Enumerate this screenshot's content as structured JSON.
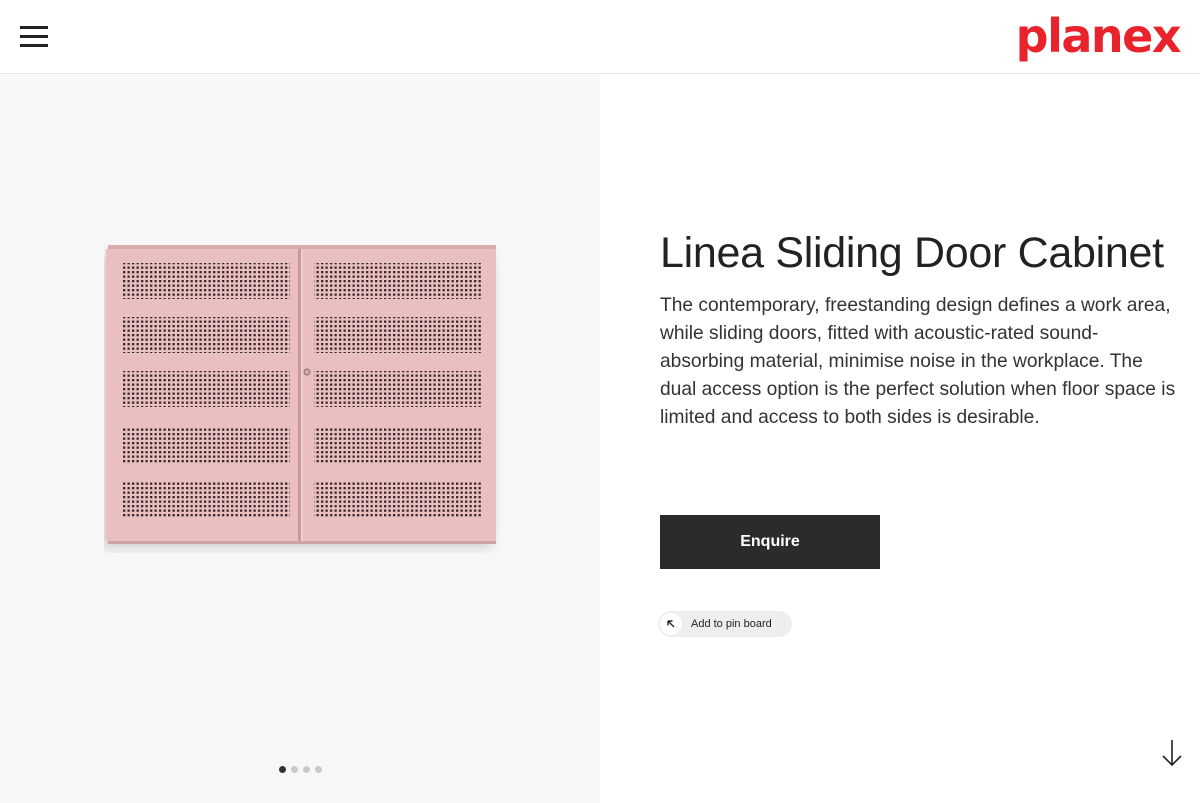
{
  "header": {
    "menu_icon": "hamburger-menu-icon",
    "logo_text": "planex",
    "logo_color": "#e8232b"
  },
  "gallery": {
    "image_alt": "pink perforated sliding door cabinet",
    "dots": [
      {
        "active": true
      },
      {
        "active": false
      },
      {
        "active": false
      },
      {
        "active": false
      }
    ]
  },
  "product": {
    "title": "Linea Sliding Door Cabinet",
    "description": "The contemporary, freestanding design defines a work area, while sliding doors, fitted with acoustic-rated sound-absorbing material, minimise noise in the workplace. The dual access option is the perfect solution when floor space is limited and access to both sides is desirable.",
    "enquire_label": "Enquire",
    "pin_label": "Add to pin board",
    "pin_icon": "arrow-up-left-icon"
  },
  "scroll_icon": "arrow-down-icon",
  "colors": {
    "cabinet": "#e9c0bf",
    "button": "#2b2b2b"
  }
}
